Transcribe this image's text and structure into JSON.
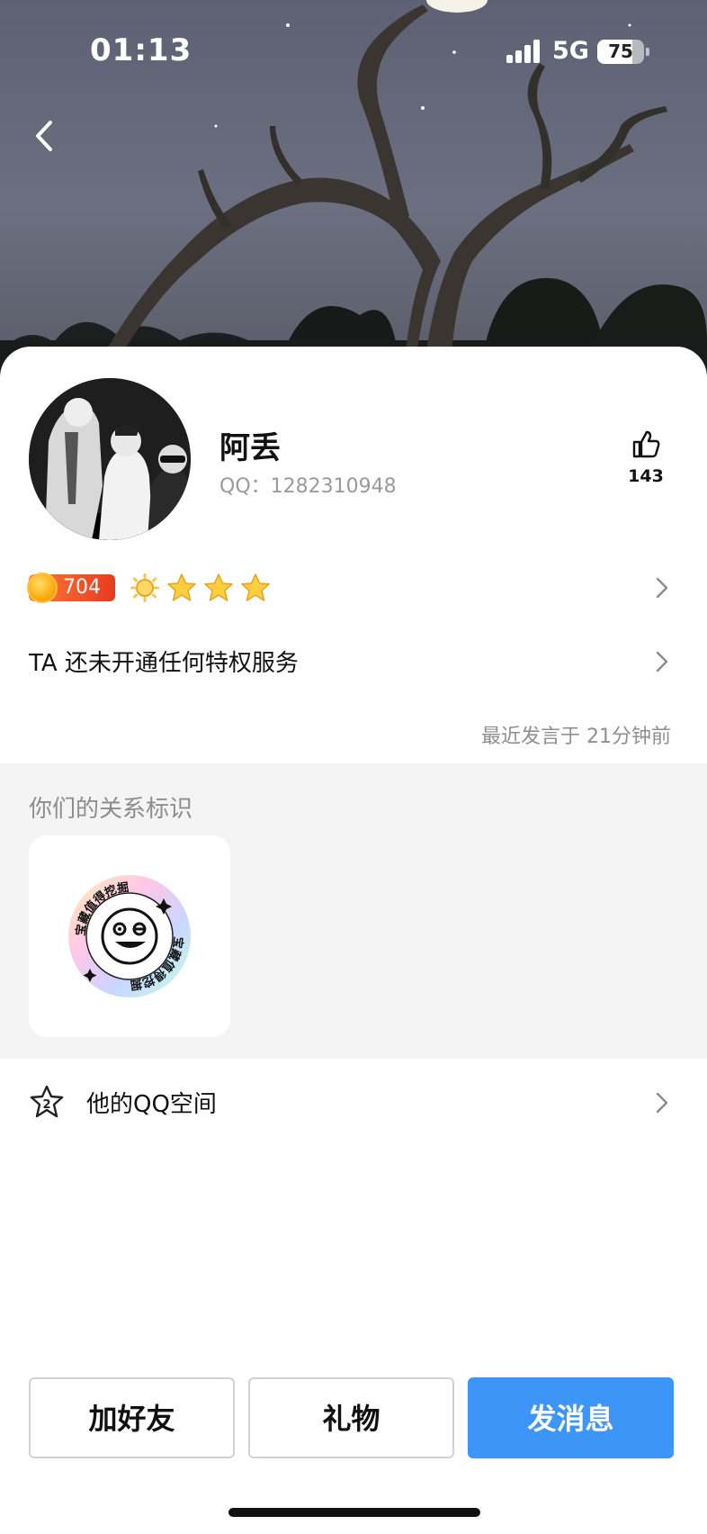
{
  "status_bar": {
    "time": "01:13",
    "network": "5G",
    "battery": "75",
    "battery_level": 0.75
  },
  "profile": {
    "name": "阿丢",
    "qq_label": "QQ：1282310948",
    "like_count": "143",
    "level": "704",
    "star_count": 3,
    "privilege_text": "TA 还未开通任何特权服务",
    "last_seen": "最近发言于 21分钟前"
  },
  "relation": {
    "title": "你们的关系标识",
    "badge_ring_text": "宝藏值得挖掘"
  },
  "qzone": {
    "label": "他的QQ空间",
    "icon_number": "2"
  },
  "actions": {
    "add_friend": "加好友",
    "gift": "礼物",
    "send_message": "发消息"
  },
  "colors": {
    "primary": "#3e95f8",
    "hero_bg": "#62667a",
    "level_badge": "#e8391d"
  },
  "icons": [
    "back-arrow-icon",
    "signal-icon",
    "battery-icon",
    "thumbs-up-icon",
    "level-coin-icon",
    "sun-icon",
    "star-icon",
    "chevron-right-icon",
    "qzone-star-icon"
  ]
}
